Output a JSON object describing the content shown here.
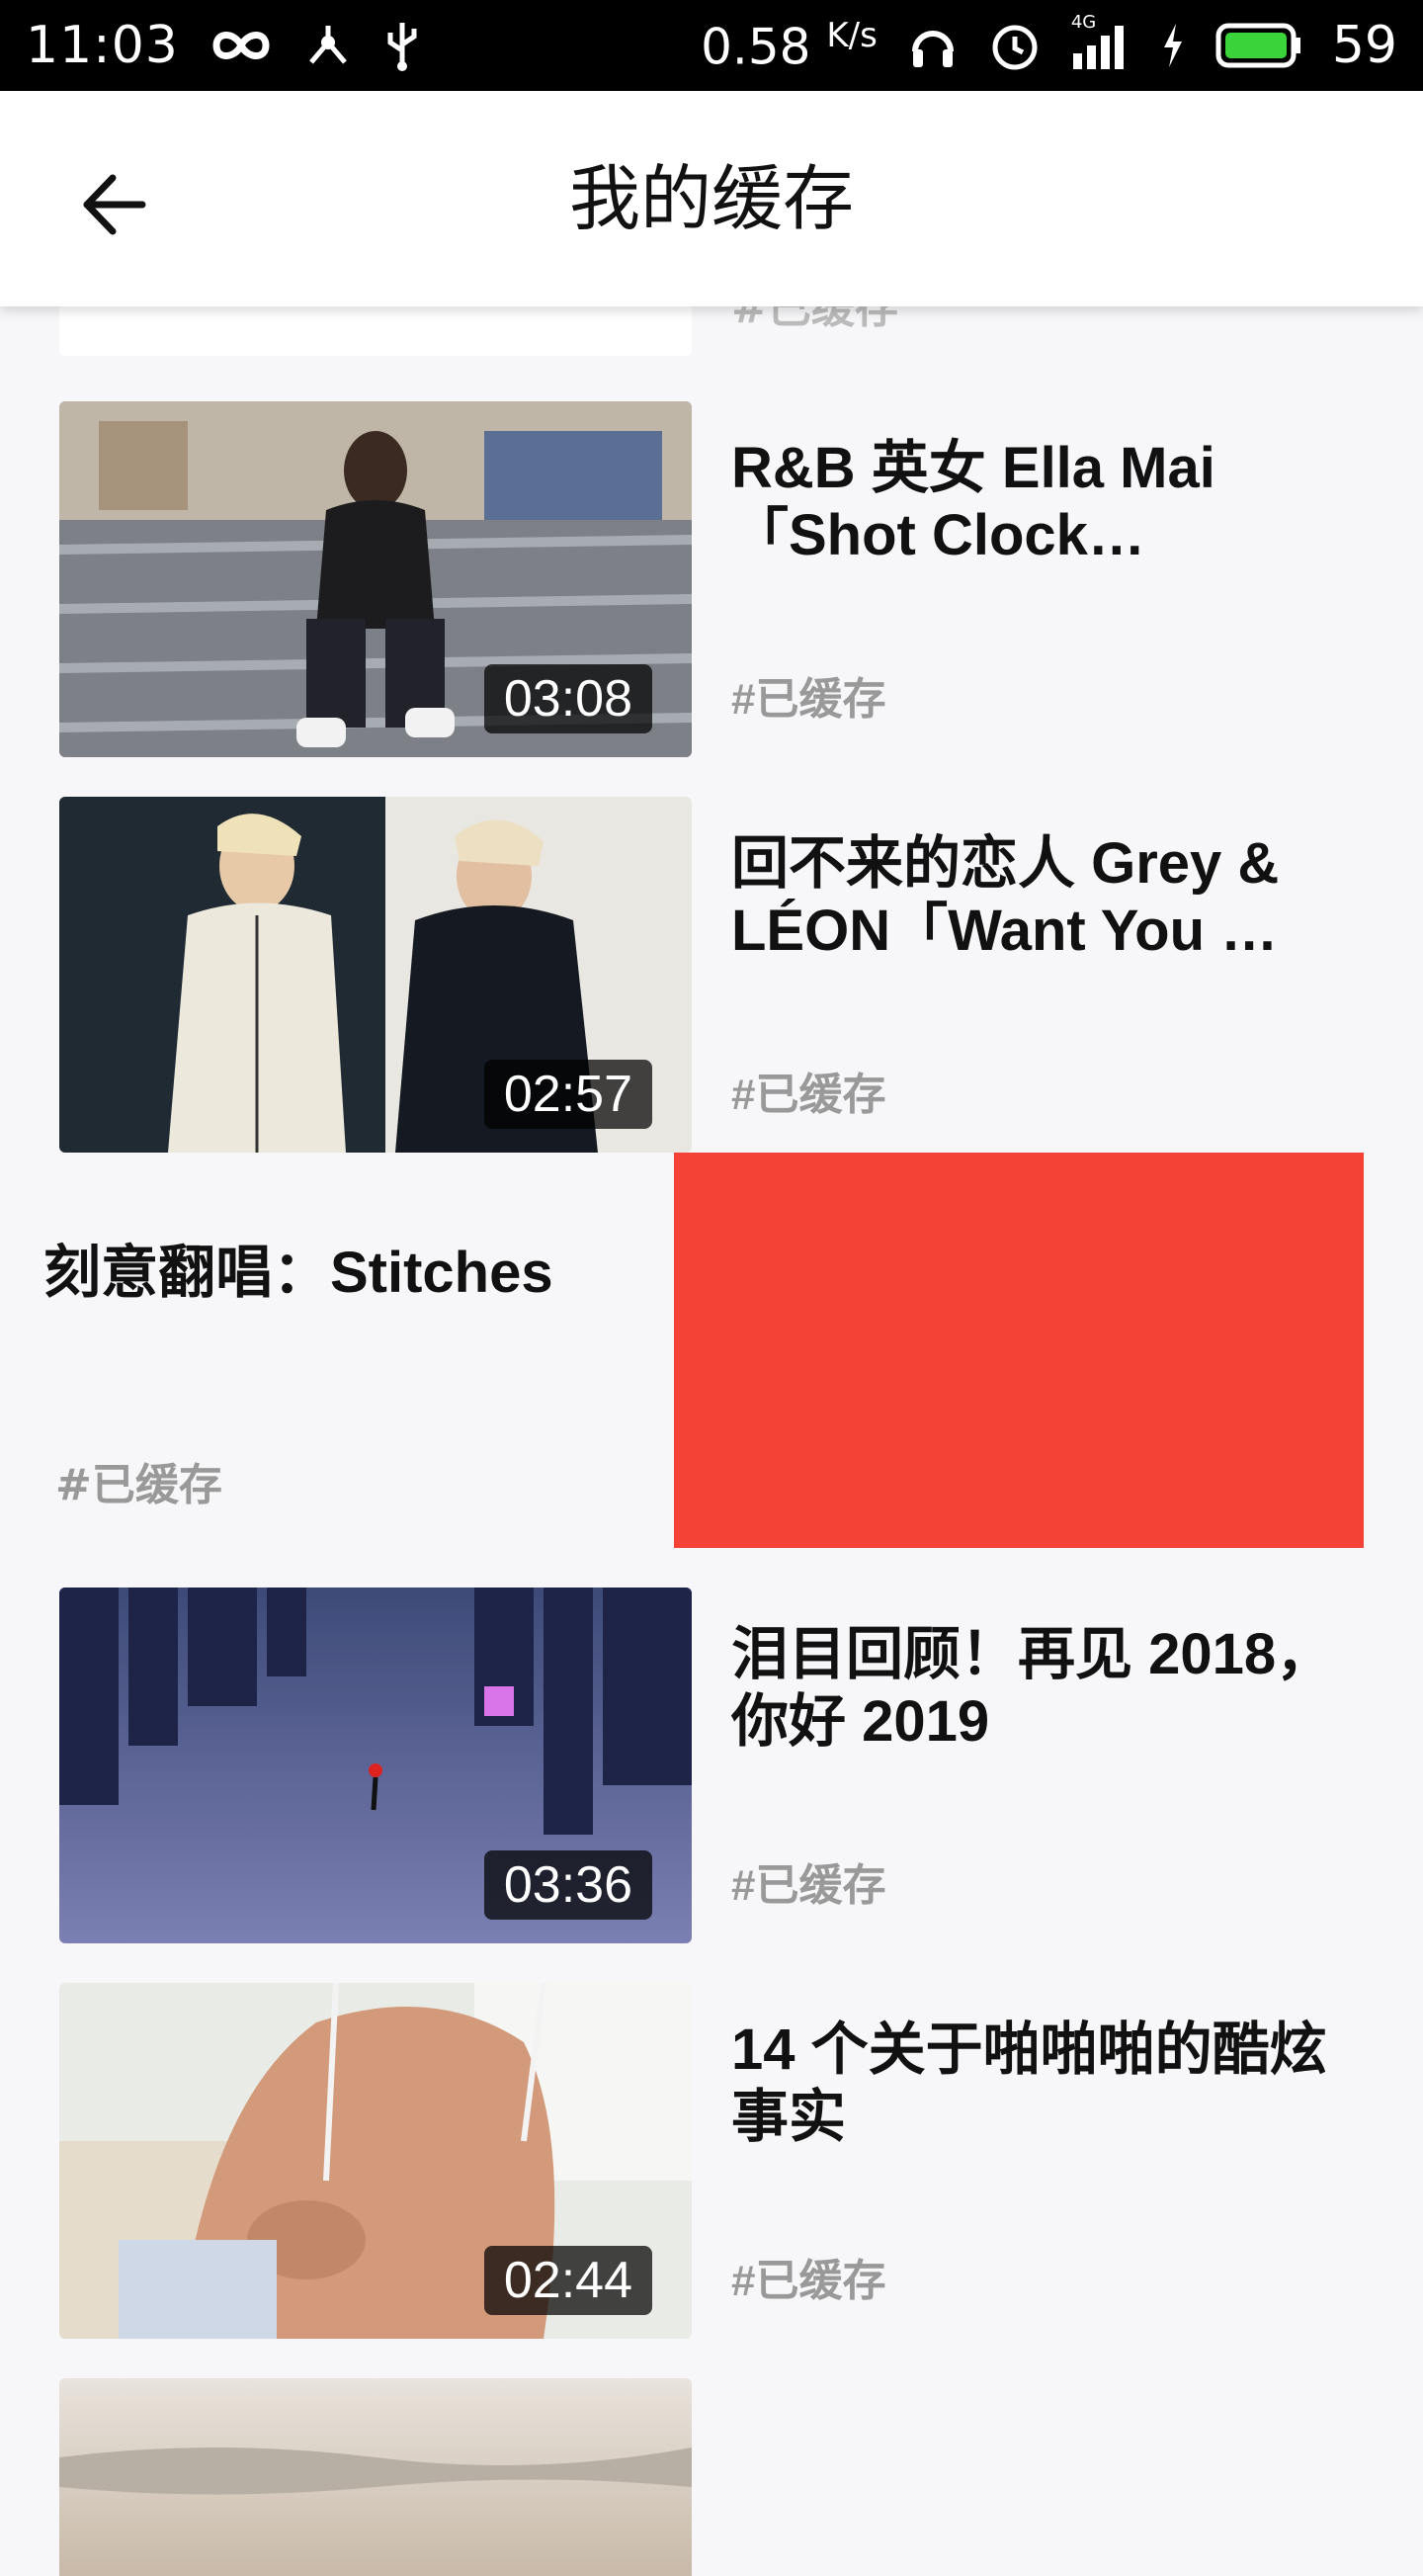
{
  "status_bar": {
    "time": "11:03",
    "speed_value": "0.58",
    "speed_unit": "K/s",
    "network": "4G",
    "battery": "59",
    "icons": [
      "infinity-icon",
      "share-network-icon",
      "usb-icon",
      "headphones-icon",
      "alarm-icon",
      "signal-icon",
      "charging-icon",
      "battery-icon"
    ]
  },
  "header": {
    "title": "我的缓存",
    "back_icon": "arrow-left-icon"
  },
  "items": [
    {
      "title": "R&B 英女 Ella Mai「Shot Clock…",
      "duration": "03:08",
      "status": "#已缓存"
    },
    {
      "title": "回不来的恋人 Grey & LÉON「Want You …",
      "duration": "02:57",
      "status": "#已缓存"
    },
    {
      "title": "泪目回顾！再见 2018，你好 2019",
      "duration": "03:36",
      "status": "#已缓存"
    },
    {
      "title": "14 个关于啪啪啪的酷炫事实",
      "duration": "02:44",
      "status": "#已缓存"
    }
  ],
  "swiped_item": {
    "title": "刻意翻唱：Stitches",
    "status": "#已缓存"
  },
  "partial_top": {
    "status": "#已缓存"
  },
  "colors": {
    "delete_red": "#f44336",
    "background": "#f7f7f9"
  }
}
